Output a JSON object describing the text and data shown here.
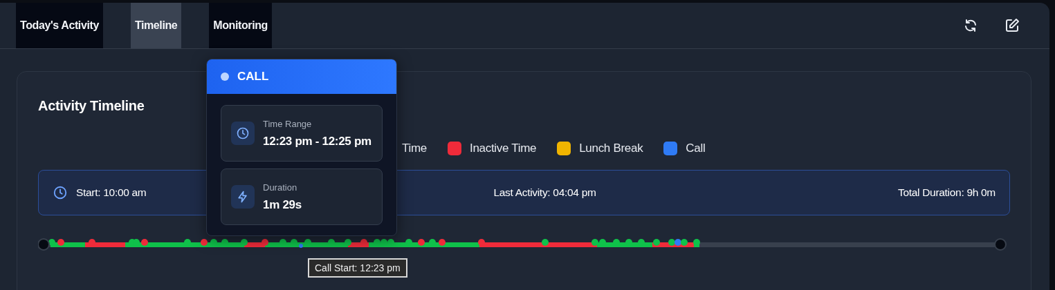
{
  "tabs": [
    {
      "label": "Today's Activity",
      "selected": false
    },
    {
      "label": "Timeline",
      "selected": true
    },
    {
      "label": "Monitoring",
      "selected": false
    }
  ],
  "panel": {
    "title": "Activity Timeline",
    "legend": [
      {
        "label": "Time"
      },
      {
        "label": "Inactive Time",
        "color": "#ef2b3a"
      },
      {
        "label": "Lunch Break",
        "color": "#f0b400"
      },
      {
        "label": "Call",
        "color": "#2f7bf5"
      }
    ],
    "stats": {
      "start": "Start: 10:00 am",
      "last_activity": "Last Activity: 04:04 pm",
      "total": "Total Duration: 9h 0m"
    },
    "hover_label": "Call Start: 12:23 pm"
  },
  "popover": {
    "title": "CALL",
    "rows": [
      {
        "kind": "time",
        "label": "Time Range",
        "value": "12:23 pm - 12:25 pm"
      },
      {
        "kind": "duration",
        "label": "Duration",
        "value": "1m 29s"
      }
    ]
  }
}
